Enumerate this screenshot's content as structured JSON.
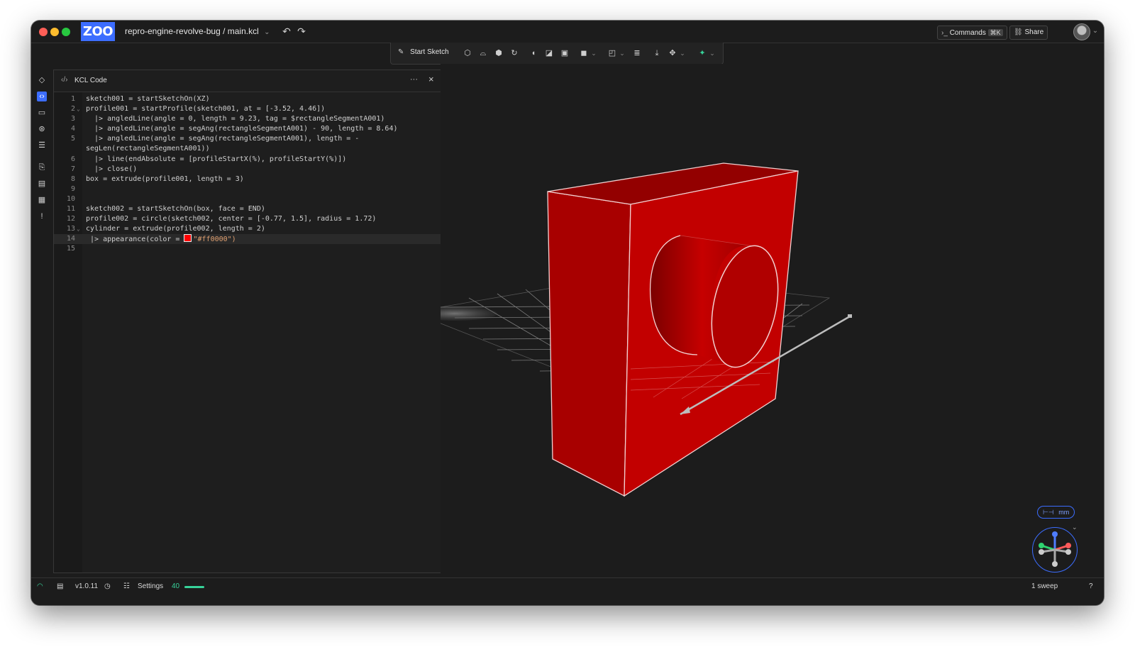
{
  "titlebar": {
    "logo": "ZOO",
    "project_path": "repro-engine-revolve-bug / main.kcl",
    "commands_label": "Commands",
    "commands_shortcut": "⌘K",
    "share_label": "Share"
  },
  "toolbar": {
    "start_sketch_label": "Start Sketch"
  },
  "panel": {
    "title": "KCL Code",
    "more": "···",
    "close": "×"
  },
  "code_lines": [
    {
      "n": "1",
      "text": "sketch001 = startSketchOn(XZ)"
    },
    {
      "n": "2",
      "fold": "⌄",
      "text": "profile001 = startProfile(sketch001, at = [-3.52, 4.46])"
    },
    {
      "n": "3",
      "text": "  |> angledLine(angle = 0, length = 9.23, tag = $rectangleSegmentA001)"
    },
    {
      "n": "4",
      "text": "  |> angledLine(angle = segAng(rectangleSegmentA001) - 90, length = 8.64)"
    },
    {
      "n": "5",
      "text": "  |> angledLine(angle = segAng(rectangleSegmentA001), length = -"
    },
    {
      "n": "",
      "text": "segLen(rectangleSegmentA001))"
    },
    {
      "n": "6",
      "text": "  |> line(endAbsolute = [profileStartX(%), profileStartY(%)])"
    },
    {
      "n": "7",
      "text": "  |> close()"
    },
    {
      "n": "8",
      "text": "box = extrude(profile001, length = 3)"
    },
    {
      "n": "9",
      "text": ""
    },
    {
      "n": "10",
      "text": ""
    },
    {
      "n": "11",
      "text": "sketch002 = startSketchOn(box, face = END)"
    },
    {
      "n": "12",
      "text": "profile002 = circle(sketch002, center = [-0.77, 1.5], radius = 1.72)"
    },
    {
      "n": "13",
      "fold": "⌄",
      "text": "cylinder = extrude(profile002, length = 2)"
    },
    {
      "n": "14",
      "active": true,
      "pre": " |> appearance(color = ",
      "swatch": "#ff0000",
      "text": "\"#ff0000\")"
    },
    {
      "n": "15",
      "text": ""
    }
  ],
  "viewport": {
    "units_label": "mm",
    "body_color": "#c00000"
  },
  "statusbar": {
    "version": "v1.0.11",
    "settings_label": "Settings",
    "fps": "40",
    "selection": "1 sweep",
    "help": "?"
  },
  "icons": {
    "undo": "↶",
    "redo": "↷",
    "chevron": "⌄"
  }
}
